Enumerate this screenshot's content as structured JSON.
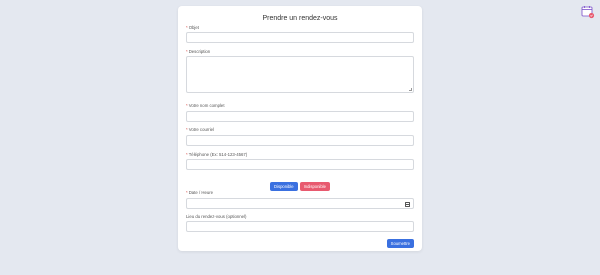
{
  "form": {
    "title": "Prendre un rendez-vous",
    "required_mark": "*",
    "fields": {
      "objet": {
        "label": "Objet",
        "value": ""
      },
      "description": {
        "label": "Description",
        "value": ""
      },
      "nom": {
        "label": "Votre nom complet",
        "value": ""
      },
      "courriel": {
        "label": "Votre courriel",
        "value": ""
      },
      "telephone": {
        "label": "Téléphone (Ex: 514-123-4567)",
        "value": ""
      },
      "date": {
        "label": "Date / Heure",
        "value": ""
      },
      "lieu": {
        "label": "Lieu du rendez-vous (optionnel)",
        "value": ""
      }
    },
    "legend": {
      "available": "Disponible",
      "unavailable": "Indisponible"
    },
    "submit_label": "Soumettre"
  },
  "colors": {
    "background": "#e4e8f0",
    "primary": "#3a70e0",
    "danger": "#e85a6f",
    "required": "#d9534f"
  },
  "icons": {
    "date_picker": "calendar-icon",
    "corner": "calendar-edit-icon"
  }
}
